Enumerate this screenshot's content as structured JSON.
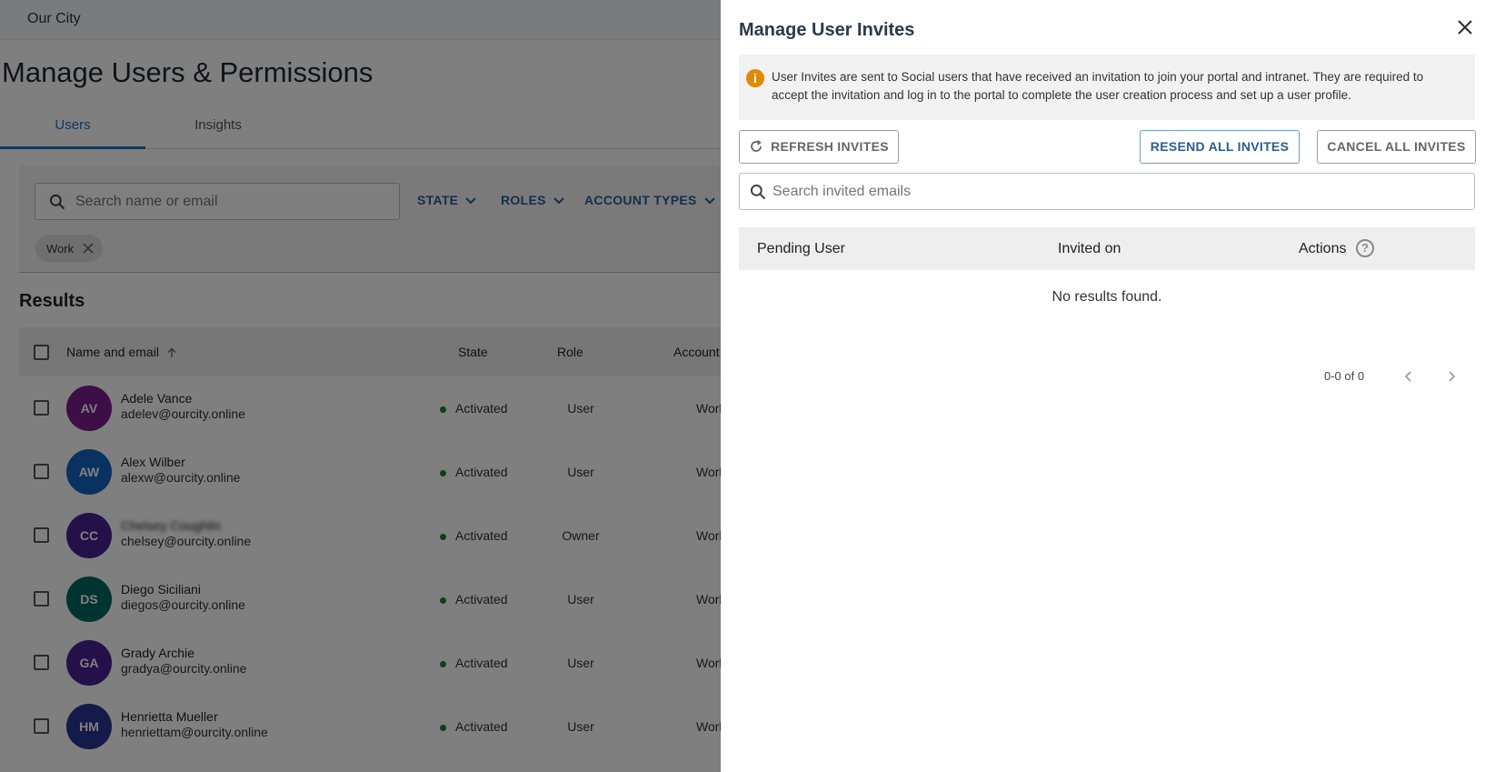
{
  "app": {
    "title": "Our City"
  },
  "page": {
    "title": "Manage Users & Permissions"
  },
  "tabs": [
    {
      "label": "Users"
    },
    {
      "label": "Insights"
    }
  ],
  "filters": {
    "search_placeholder": "Search name or email",
    "buttons": [
      {
        "label": "STATE"
      },
      {
        "label": "ROLES"
      },
      {
        "label": "ACCOUNT TYPES"
      }
    ],
    "chip": {
      "label": "Work"
    }
  },
  "results": {
    "title": "Results",
    "columns": {
      "name": "Name and email",
      "state": "State",
      "role": "Role",
      "account": "Account"
    },
    "rows": [
      {
        "initials": "AV",
        "name": "Adele Vance",
        "email": "adelev@ourcity.online",
        "state": "Activated",
        "role": "User",
        "account": "Work",
        "avatar_color": "#7b1f8c"
      },
      {
        "initials": "AW",
        "name": "Alex Wilber",
        "email": "alexw@ourcity.online",
        "state": "Activated",
        "role": "User",
        "account": "Work",
        "avatar_color": "#1565c0"
      },
      {
        "initials": "CC",
        "name": "Chelsey Coughlin",
        "email": "chelsey@ourcity.online",
        "state": "Activated",
        "role": "Owner",
        "account": "Work",
        "avatar_color": "#4a2393",
        "name_blurred": true
      },
      {
        "initials": "DS",
        "name": "Diego Siciliani",
        "email": "diegos@ourcity.online",
        "state": "Activated",
        "role": "User",
        "account": "Work",
        "avatar_color": "#00695c"
      },
      {
        "initials": "GA",
        "name": "Grady Archie",
        "email": "gradya@ourcity.online",
        "state": "Activated",
        "role": "User",
        "account": "Work",
        "avatar_color": "#4a2393"
      },
      {
        "initials": "HM",
        "name": "Henrietta Mueller",
        "email": "henriettam@ourcity.online",
        "state": "Activated",
        "role": "User",
        "account": "Work",
        "avatar_color": "#283593"
      }
    ]
  },
  "drawer": {
    "title": "Manage User Invites",
    "info_text": "User Invites are sent to Social users that have received an invitation to join your portal and intranet. They are required to accept the invitation and log in to the portal to complete the user creation process and set up a user profile.",
    "buttons": {
      "refresh": "REFRESH INVITES",
      "resend": "RESEND ALL INVITES",
      "cancel": "CANCEL ALL INVITES"
    },
    "search_placeholder": "Search invited emails",
    "columns": {
      "pending": "Pending User",
      "invited": "Invited on",
      "actions": "Actions"
    },
    "empty": "No results found.",
    "pagination": {
      "label": "0-0 of 0"
    }
  },
  "colors": {
    "accent": "#2a5c94",
    "info": "#e08a00",
    "status_active": "#1e7d32"
  }
}
